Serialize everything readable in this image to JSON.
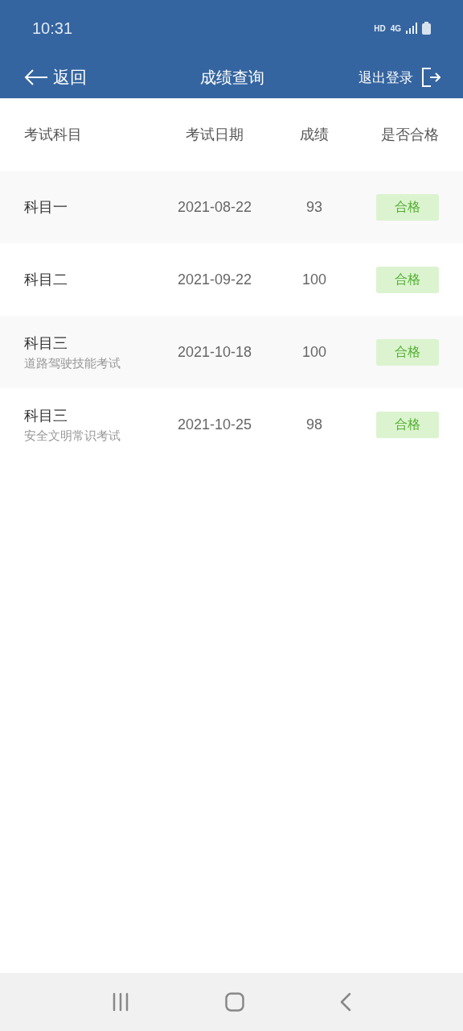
{
  "status_bar": {
    "time": "10:31",
    "hd": "HD",
    "network": "4G"
  },
  "header": {
    "back": "返回",
    "title": "成绩查询",
    "logout": "退出登录"
  },
  "table": {
    "columns": [
      "考试科目",
      "考试日期",
      "成绩",
      "是否合格"
    ],
    "rows": [
      {
        "subject": "科目一",
        "date": "2021-08-22",
        "score": "93",
        "result": "合格",
        "passed": true
      },
      {
        "subject": "科目二",
        "date": "2021-09-22",
        "score": "100",
        "result": "合格",
        "passed": true
      },
      {
        "subject": "科目三",
        "note": "道路驾驶技能考试",
        "date": "2021-10-18",
        "score": "100",
        "result": "合格",
        "passed": true
      },
      {
        "subject": "科目三",
        "note": "安全文明常识考试",
        "date": "2021-10-25",
        "score": "98",
        "result": "合格",
        "passed": true
      }
    ]
  }
}
